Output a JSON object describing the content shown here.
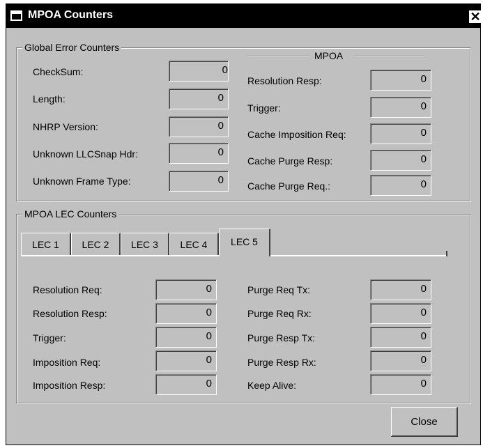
{
  "window": {
    "title": "MPOA Counters",
    "close_glyph": "✕"
  },
  "global": {
    "legend": "Global Error Counters",
    "rows": [
      {
        "label": "CheckSum:",
        "value": "0"
      },
      {
        "label": "Length:",
        "value": "0"
      },
      {
        "label": "NHRP Version:",
        "value": "0"
      },
      {
        "label": "Unknown LLCSnap Hdr:",
        "value": "0"
      },
      {
        "label": "Unknown Frame Type:",
        "value": "0"
      }
    ]
  },
  "mpoa": {
    "heading": "MPOA",
    "rows": [
      {
        "label": "Resolution Resp:",
        "value": "0"
      },
      {
        "label": "Trigger:",
        "value": "0"
      },
      {
        "label": "Cache Imposition Req:",
        "value": "0"
      },
      {
        "label": "Cache Purge Resp:",
        "value": "0"
      },
      {
        "label": "Cache Purge Req.:",
        "value": "0"
      }
    ]
  },
  "lec": {
    "legend": "MPOA LEC Counters",
    "tabs": [
      "LEC 1",
      "LEC 2",
      "LEC 3",
      "LEC 4",
      "LEC 5"
    ],
    "active_tab": "LEC 5",
    "left_rows": [
      {
        "label": "Resolution Req:",
        "value": "0"
      },
      {
        "label": "Resolution Resp:",
        "value": "0"
      },
      {
        "label": "Trigger:",
        "value": "0"
      },
      {
        "label": "Imposition Req:",
        "value": "0"
      },
      {
        "label": "Imposition Resp:",
        "value": "0"
      }
    ],
    "right_rows": [
      {
        "label": "Purge Req Tx:",
        "value": "0"
      },
      {
        "label": "Purge Req Rx:",
        "value": "0"
      },
      {
        "label": "Purge Resp Tx:",
        "value": "0"
      },
      {
        "label": "Purge Resp Rx:",
        "value": "0"
      },
      {
        "label": "Keep Alive:",
        "value": "0"
      }
    ]
  },
  "buttons": {
    "close_label": "Close"
  }
}
